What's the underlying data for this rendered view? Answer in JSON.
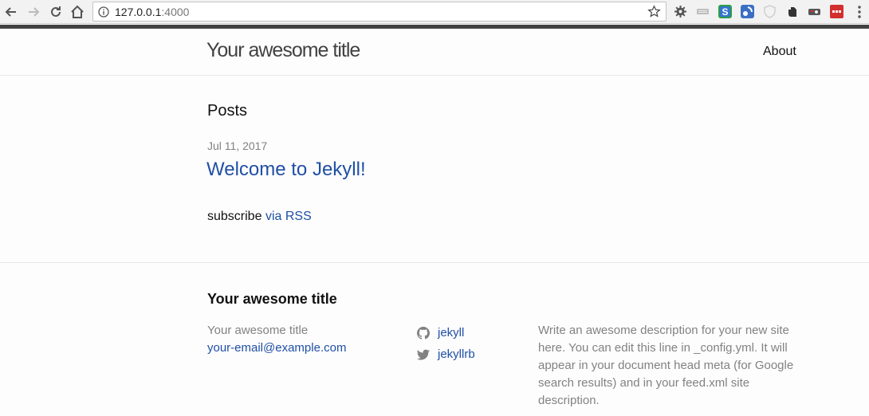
{
  "browser": {
    "url_host": "127.0.0.1",
    "url_port": ":4000",
    "back_icon": "back-arrow-icon",
    "forward_icon": "forward-arrow-icon",
    "reload_icon": "reload-icon",
    "home_icon": "home-icon",
    "info_icon": "info-icon",
    "bookmark_icon": "star-icon",
    "extensions": [
      "gear-icon",
      "keyboard-icon",
      "s-badge-icon",
      "feed-icon",
      "shield-icon",
      "evernote-icon",
      "bookmark-hub-icon",
      "sync-icon"
    ],
    "accent_color": "#424242"
  },
  "header": {
    "site_title": "Your awesome title",
    "nav": {
      "about": "About"
    }
  },
  "main": {
    "posts_heading": "Posts",
    "posts": [
      {
        "date": "Jul 11, 2017",
        "title": "Welcome to Jekyll!"
      }
    ],
    "subscribe_text": "subscribe",
    "subscribe_link": "via RSS",
    "link_color": "#1f4fa5"
  },
  "footer": {
    "heading": "Your awesome title",
    "col1": {
      "name": "Your awesome title",
      "email": "your-email@example.com"
    },
    "col2": {
      "github": {
        "icon": "github-icon",
        "username": "jekyll"
      },
      "twitter": {
        "icon": "twitter-icon",
        "username": "jekyllrb"
      }
    },
    "description": "Write an awesome description for your new site here. You can edit this line in _config.yml. It will appear in your document head meta (for Google search results) and in your feed.xml site description."
  }
}
